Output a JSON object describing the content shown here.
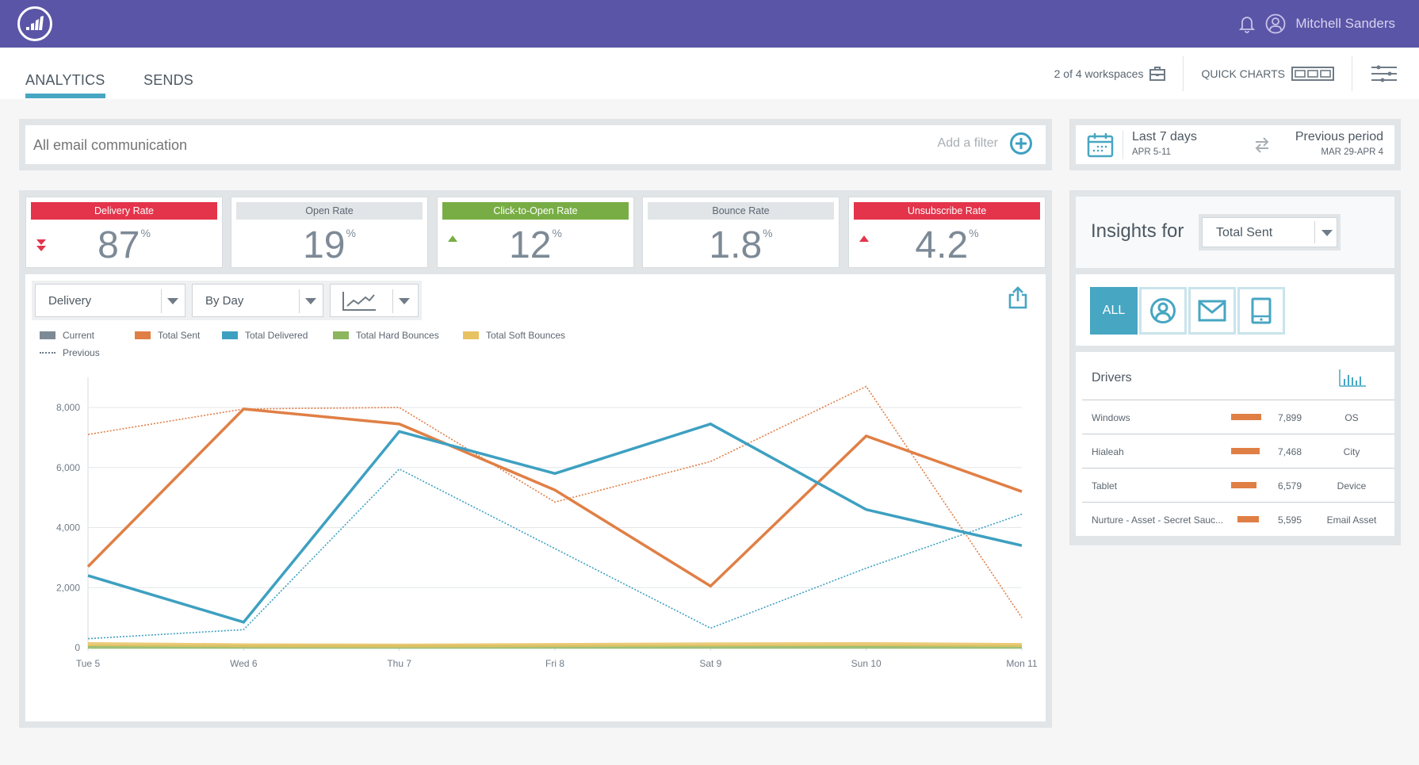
{
  "header": {
    "user_name": "Mitchell Sanders",
    "brand_color": "#5a55a6"
  },
  "tabs": [
    {
      "label": "ANALYTICS",
      "active": true
    },
    {
      "label": "SENDS",
      "active": false
    }
  ],
  "toolbar": {
    "workspaces": "2 of 4 workspaces",
    "quick_charts": "QUICK CHARTS"
  },
  "filter": {
    "placeholder": "All email communication",
    "add_filter_label": "Add a filter"
  },
  "date_range": {
    "current_label": "Last 7 days",
    "current_range": "APR 5-11",
    "compare_label": "Previous period",
    "compare_range": "MAR 29-APR 4"
  },
  "kpis": [
    {
      "label": "Delivery Rate",
      "value": "87",
      "unit": "%",
      "status": "red",
      "trend": "down-double"
    },
    {
      "label": "Open Rate",
      "value": "19",
      "unit": "%",
      "status": "grey",
      "trend": "none"
    },
    {
      "label": "Click-to-Open Rate",
      "value": "12",
      "unit": "%",
      "status": "green",
      "trend": "up"
    },
    {
      "label": "Bounce Rate",
      "value": "1.8",
      "unit": "%",
      "status": "grey",
      "trend": "none"
    },
    {
      "label": "Unsubscribe Rate",
      "value": "4.2",
      "unit": "%",
      "status": "red",
      "trend": "up"
    }
  ],
  "chart_controls": {
    "metric": "Delivery",
    "grouping": "By Day",
    "chart_type_icon": "line-chart-icon"
  },
  "legend": {
    "current": "Current",
    "previous": "Previous",
    "series": [
      {
        "name": "Total Sent",
        "color": "#e07f45"
      },
      {
        "name": "Total Delivered",
        "color": "#3ea0c1"
      },
      {
        "name": "Total Hard Bounces",
        "color": "#8cb560"
      },
      {
        "name": "Total Soft Bounces",
        "color": "#e8c262"
      }
    ]
  },
  "chart_data": {
    "type": "line",
    "title": "",
    "xlabel": "",
    "ylabel": "",
    "x": [
      "Tue 5",
      "Wed 6",
      "Thu 7",
      "Fri 8",
      "Sat 9",
      "Sun 10",
      "Mon 11"
    ],
    "yticks": [
      0,
      2000,
      4000,
      6000,
      8000
    ],
    "ytick_labels": [
      "0",
      "2,000",
      "4,000",
      "6,000",
      "8,000"
    ],
    "ylim": [
      0,
      8800
    ],
    "grid": true,
    "legend_position": "top-left",
    "series": [
      {
        "name": "Total Sent",
        "period": "Current",
        "style": "solid",
        "color": "#e07f45",
        "values": [
          2700,
          7950,
          7450,
          5250,
          2050,
          7050,
          5200
        ]
      },
      {
        "name": "Total Delivered",
        "period": "Current",
        "style": "solid",
        "color": "#3ea0c1",
        "values": [
          2400,
          850,
          7200,
          5800,
          7450,
          4600,
          3400
        ]
      },
      {
        "name": "Total Hard Bounces",
        "period": "Current",
        "style": "solid",
        "color": "#8cb560",
        "values": [
          30,
          30,
          30,
          30,
          30,
          30,
          30
        ]
      },
      {
        "name": "Total Soft Bounces",
        "period": "Current",
        "style": "solid",
        "color": "#e8c262",
        "values": [
          120,
          80,
          70,
          90,
          110,
          120,
          90
        ]
      },
      {
        "name": "Total Sent",
        "period": "Previous",
        "style": "dotted",
        "color": "#e07f45",
        "values": [
          7100,
          7950,
          8000,
          4850,
          6200,
          8700,
          1000
        ]
      },
      {
        "name": "Total Delivered",
        "period": "Previous",
        "style": "dotted",
        "color": "#3ea0c1",
        "values": [
          300,
          600,
          5950,
          3300,
          650,
          2650,
          4450
        ]
      },
      {
        "name": "Total Soft Bounces",
        "period": "Previous",
        "style": "dotted",
        "color": "#e8c262",
        "values": [
          60,
          50,
          40,
          60,
          70,
          60,
          50
        ]
      }
    ]
  },
  "insights": {
    "title": "Insights for",
    "metric": "Total Sent",
    "segments": [
      {
        "label": "ALL",
        "icon": "all",
        "active": true
      },
      {
        "label": "",
        "icon": "person-icon",
        "active": false
      },
      {
        "label": "",
        "icon": "envelope-icon",
        "active": false
      },
      {
        "label": "",
        "icon": "tablet-icon",
        "active": false
      }
    ],
    "drivers_title": "Drivers",
    "drivers": [
      {
        "name": "Windows",
        "value": "7,899",
        "numeric": 7899,
        "category": "OS"
      },
      {
        "name": "Hialeah",
        "value": "7,468",
        "numeric": 7468,
        "category": "City"
      },
      {
        "name": "Tablet",
        "value": "6,579",
        "numeric": 6579,
        "category": "Device"
      },
      {
        "name": "Nurture - Asset - Secret Sauc...",
        "value": "5,595",
        "numeric": 5595,
        "category": "Email Asset"
      }
    ]
  }
}
